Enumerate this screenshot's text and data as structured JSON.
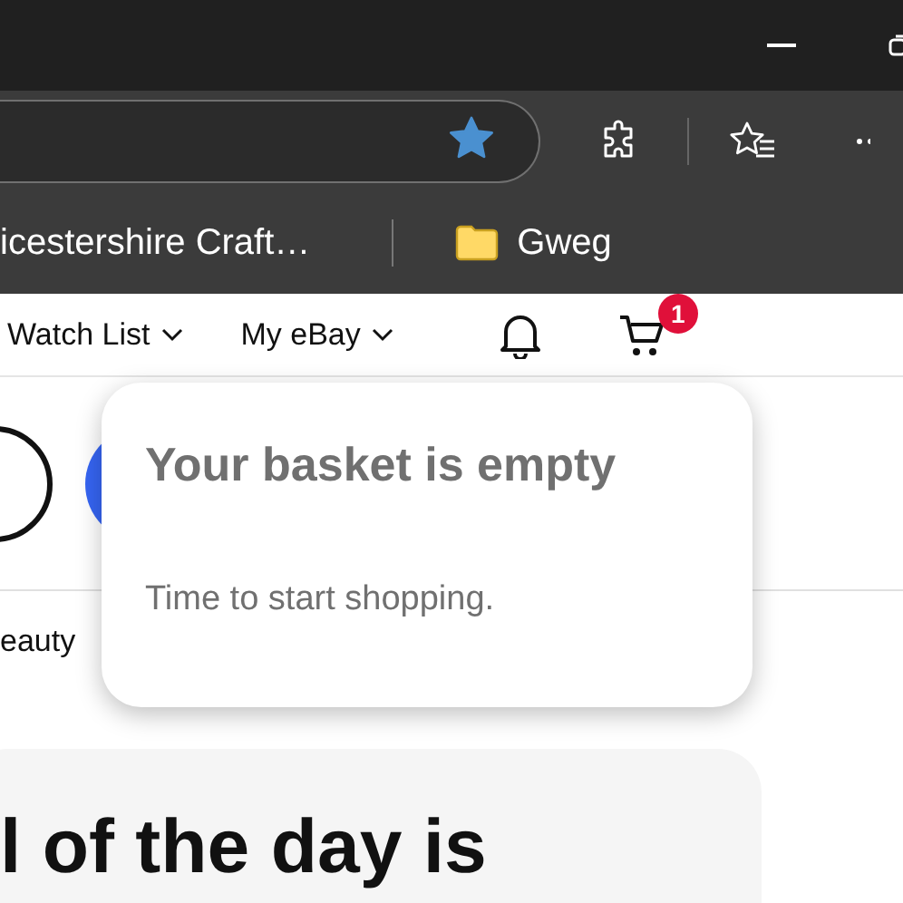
{
  "browser": {
    "address_bar": {
      "favorited": true
    },
    "bookmarks": [
      {
        "label": "icestershire Craft…",
        "kind": "page"
      },
      {
        "label": "Gweg",
        "kind": "folder"
      }
    ]
  },
  "nav": [
    {
      "label": "Watch List",
      "dropdown": true
    },
    {
      "label": "My eBay",
      "dropdown": true
    }
  ],
  "cart": {
    "badge": "1"
  },
  "categories": [
    "eauty"
  ],
  "basket_popup": {
    "title": "Your basket is empty",
    "message": "Time to start shopping."
  },
  "deal_heading": "l of the day is"
}
